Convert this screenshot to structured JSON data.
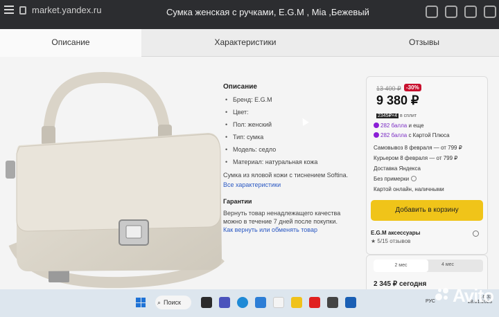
{
  "browser": {
    "url": "market.yandex.ru",
    "page_title": "Сумка женская с ручками, E.G.M , Mia ,Бежевый"
  },
  "tabs": [
    {
      "label": "Описание",
      "active": true
    },
    {
      "label": "Характеристики",
      "active": false
    },
    {
      "label": "Отзывы",
      "active": false
    }
  ],
  "description": {
    "heading": "Описание",
    "items": [
      "Бренд: E.G.M",
      "Цвет:",
      "Пол: женский",
      "Тип: сумка",
      "Модель: седло",
      "Материал: натуральная кожа"
    ],
    "paragraph": "Сумка из яловой кожи с тиснением Softina.",
    "all_specs_link": "Все характеристики",
    "guarantee_heading": "Гарантии",
    "guarantee_text": "Вернуть товар ненадлежащего качества можно в течение 7 дней после покупки.",
    "return_link": "Как вернуть или обменять товар"
  },
  "offer": {
    "old_price": "13 400 ₽",
    "discount": "-30%",
    "price": "9 380 ₽",
    "split_badge": "2345₽×4",
    "split_text": "в сплит",
    "bonus1_points": "282 балла",
    "bonus1_text": "и еще",
    "bonus2_points": "282 балла",
    "bonus2_text": "с Картой Плюса",
    "pickup": "Самовывоз 8 февраля — от 799 ₽",
    "courier": "Курьером 8 февраля — от 799 ₽",
    "delivery_by": "Доставка Яндекса",
    "fitting": "Без примерки",
    "payment": "Картой онлайн, наличными",
    "cart_button": "Добавить в корзину",
    "seller": "E.G.M аксессуары",
    "rating": "★ 5/15 отзывов"
  },
  "installment": {
    "option1": "2 мес",
    "option2": "4 мес",
    "today": "2 345 ₽ сегодня"
  },
  "taskbar": {
    "search_label": "Поиск",
    "lang": "РУС",
    "time": "16:33",
    "date": "28.01.2023"
  },
  "watermark": "Avito"
}
